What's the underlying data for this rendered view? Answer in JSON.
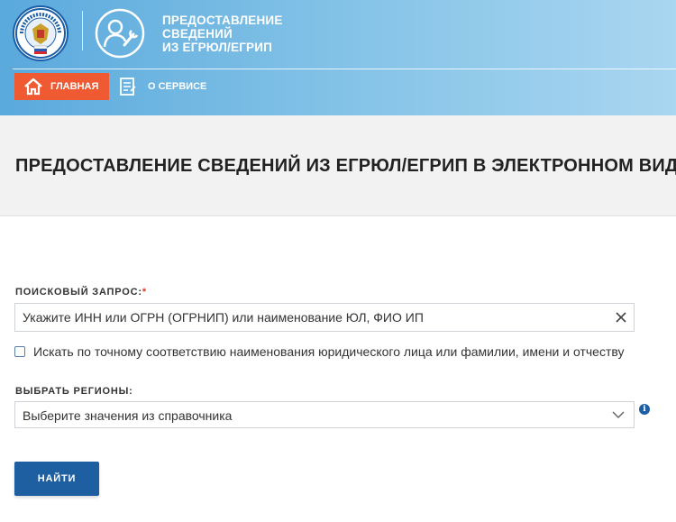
{
  "header": {
    "logo": {
      "icon": "fns-emblem-icon",
      "ring_text": "ФЕДЕРАЛЬНАЯ НАЛОГОВАЯ СЛУЖБА"
    },
    "service_icon": "service-worker-wrench-icon",
    "service_title_lines": [
      "ПРЕДОСТАВЛЕНИЕ",
      "СВЕДЕНИЙ",
      "ИЗ ЕГРЮЛ/ЕГРИП"
    ],
    "nav": [
      {
        "label": "ГЛАВНАЯ",
        "icon": "home-icon",
        "active": true
      },
      {
        "label": "О СЕРВИСЕ",
        "icon": "document-icon",
        "active": false
      }
    ]
  },
  "page": {
    "title": "ПРЕДОСТАВЛЕНИЕ СВЕДЕНИЙ ИЗ ЕГРЮЛ/ЕГРИП В ЭЛЕКТРОННОМ ВИДЕ"
  },
  "form": {
    "query_label": "ПОИСКОВЫЙ ЗАПРОС:",
    "required_mark": "*",
    "query_placeholder": "Укажите ИНН или ОГРН (ОГРНИП) или наименование ЮЛ, ФИО ИП",
    "query_value": "",
    "exact_match_label": "Искать по точному соответствию наименования юридического лица или фамилии, имени и отчеству",
    "exact_match_checked": false,
    "regions_label": "ВЫБРАТЬ РЕГИОНЫ:",
    "regions_placeholder": "Выберите значения из справочника",
    "info_icon": "info-icon",
    "submit_label": "НАЙТИ"
  },
  "colors": {
    "header_gradient_start": "#5aa9dc",
    "header_gradient_end": "#a9d6f0",
    "nav_active": "#ef5a33",
    "primary_button": "#1e5fa2",
    "required": "#e23b1f",
    "title_band": "#f2f2f2"
  }
}
